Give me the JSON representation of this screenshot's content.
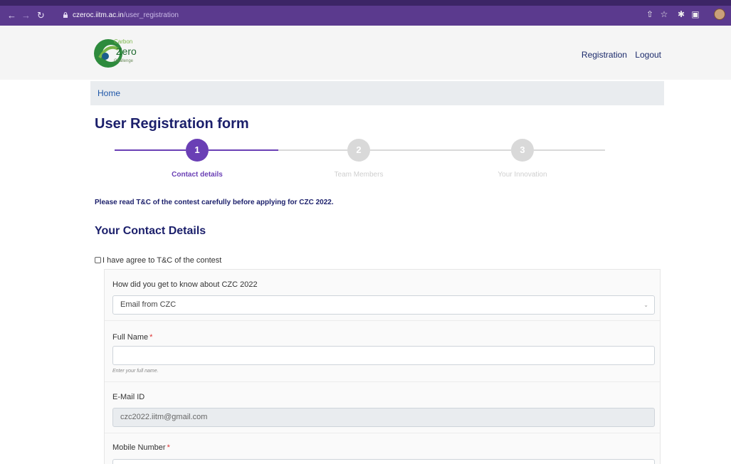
{
  "browser": {
    "url_host": "czeroc.iitm.ac.in",
    "url_path": "/user_registration"
  },
  "logo": {
    "line1": "Carbon",
    "line2": "Zero",
    "line3": "Challenge"
  },
  "header": {
    "links": [
      "Registration",
      "Logout"
    ]
  },
  "breadcrumb": {
    "home": "Home"
  },
  "page": {
    "title": "User Registration form"
  },
  "stepper": {
    "steps": [
      {
        "number": "1",
        "label": "Contact details",
        "active": true
      },
      {
        "number": "2",
        "label": "Team Members",
        "active": false
      },
      {
        "number": "3",
        "label": "Your Innovation",
        "active": false
      }
    ],
    "active_color": "#6a3fb5",
    "inactive_color": "#d9d9d9"
  },
  "notice": "Please read T&C of the contest carefully before applying for CZC 2022.",
  "section": {
    "title": "Your Contact Details"
  },
  "agreement": {
    "label": "I have agree to T&C of the contest",
    "checked": false
  },
  "form": {
    "source": {
      "label": "How did you get to know about CZC 2022",
      "value": "Email from CZC"
    },
    "full_name": {
      "label": "Full Name",
      "required_mark": "*",
      "value": "",
      "help": "Enter your full name."
    },
    "email": {
      "label": "E-Mail ID",
      "value": "czc2022.iitm@gmail.com"
    },
    "mobile": {
      "label": "Mobile Number",
      "required_mark": "*"
    }
  }
}
